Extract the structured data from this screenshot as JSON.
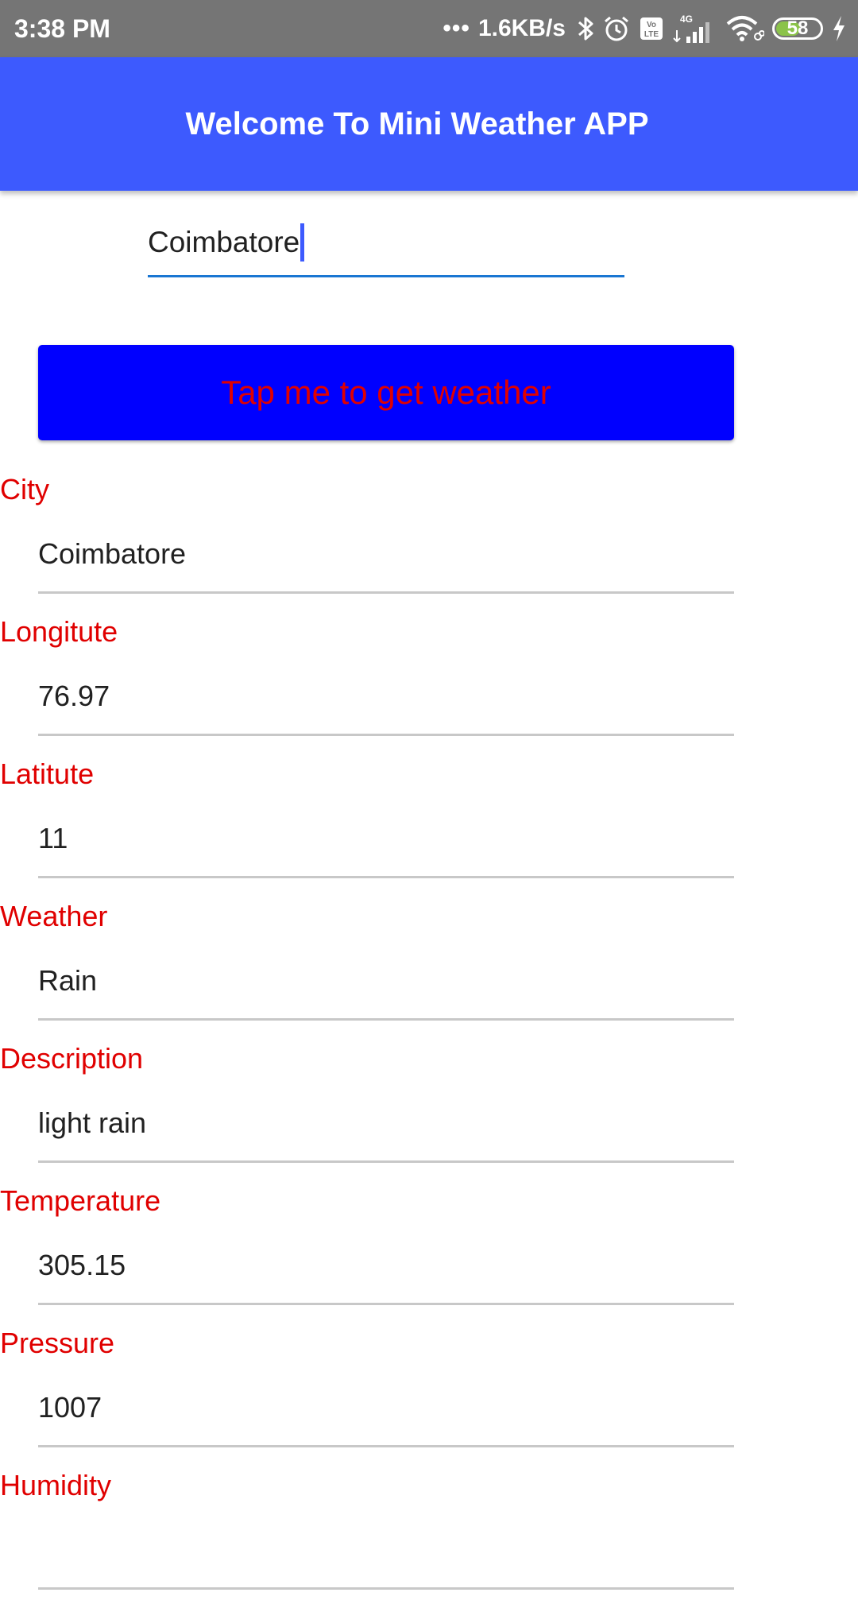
{
  "status_bar": {
    "time": "3:38 PM",
    "dots": "•••",
    "net_speed": "1.6KB/s",
    "battery_level": "58",
    "battery_fraction": 0.58,
    "icons": [
      "bluetooth-icon",
      "alarm-icon",
      "volte-icon",
      "signal-4g-icon",
      "wifi-icon",
      "battery-icon",
      "charging-icon"
    ]
  },
  "app_bar": {
    "title": "Welcome To Mini Weather APP"
  },
  "search": {
    "value": "Coimbatore"
  },
  "button": {
    "label": "Tap me to get weather"
  },
  "fields": [
    {
      "label": "City",
      "value": "Coimbatore"
    },
    {
      "label": "Longitute",
      "value": "76.97"
    },
    {
      "label": "Latitute",
      "value": "11"
    },
    {
      "label": "Weather",
      "value": "Rain"
    },
    {
      "label": "Description",
      "value": "light rain"
    },
    {
      "label": "Temperature",
      "value": "305.15"
    },
    {
      "label": "Pressure",
      "value": "1007"
    },
    {
      "label": "Humidity",
      "value": ""
    }
  ],
  "colors": {
    "status_bar_bg": "#757575",
    "app_bar_bg": "#3d5afe",
    "button_bg": "#0000ff",
    "label_red": "#e00000",
    "input_underline_focused": "#1976d2",
    "field_underline": "#c8c8c8"
  }
}
